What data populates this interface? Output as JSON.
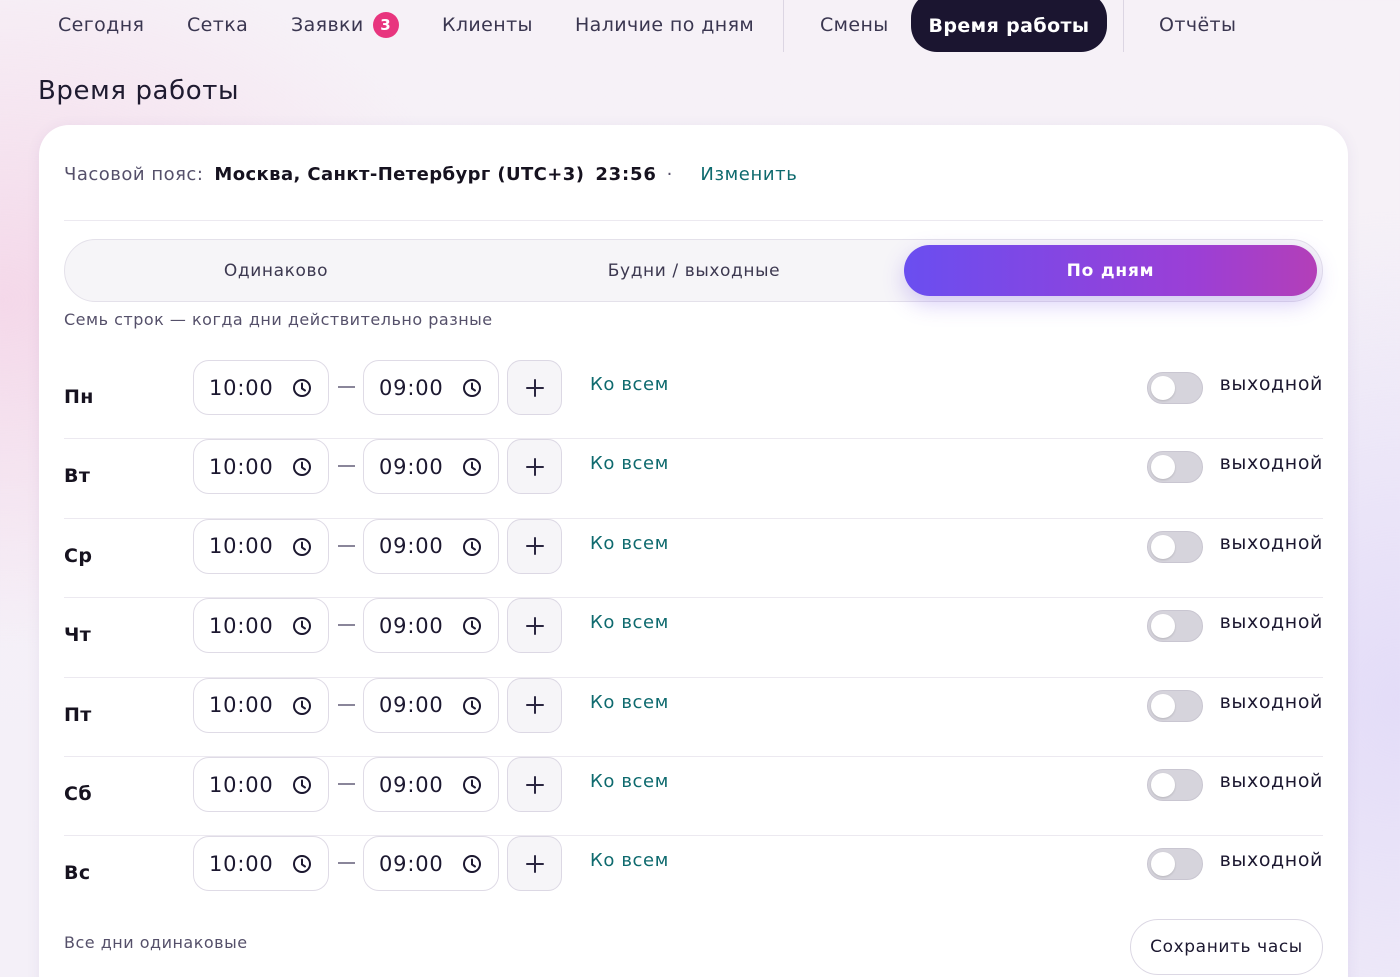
{
  "nav": {
    "items": [
      {
        "label": "Сегодня"
      },
      {
        "label": "Сетка"
      },
      {
        "label": "Заявки",
        "badge": "3"
      },
      {
        "label": "Клиенты"
      },
      {
        "label": "Наличие по дням"
      },
      {
        "label": "Смены"
      },
      {
        "label": "Время работы",
        "active": true
      },
      {
        "label": "Отчёты"
      }
    ]
  },
  "page": {
    "title": "Время работы"
  },
  "timezone": {
    "label": "Часовой пояс:",
    "value": "Москва, Санкт-Петербург (UTC+3)",
    "time": "23:56",
    "separator": "·",
    "change_label": "Изменить"
  },
  "mode": {
    "options": [
      "Одинаково",
      "Будни / выходные",
      "По дням"
    ],
    "selected": "По дням",
    "hint": "Семь строк — когда дни действительно разные"
  },
  "days": [
    {
      "label": "Пн",
      "from": "10:00",
      "to": "09:00",
      "to_all": "Ко всем",
      "day_off": false,
      "day_off_label": "выходной"
    },
    {
      "label": "Вт",
      "from": "10:00",
      "to": "09:00",
      "to_all": "Ко всем",
      "day_off": false,
      "day_off_label": "выходной"
    },
    {
      "label": "Ср",
      "from": "10:00",
      "to": "09:00",
      "to_all": "Ко всем",
      "day_off": false,
      "day_off_label": "выходной"
    },
    {
      "label": "Чт",
      "from": "10:00",
      "to": "09:00",
      "to_all": "Ко всем",
      "day_off": false,
      "day_off_label": "выходной"
    },
    {
      "label": "Пт",
      "from": "10:00",
      "to": "09:00",
      "to_all": "Ко всем",
      "day_off": false,
      "day_off_label": "выходной"
    },
    {
      "label": "Сб",
      "from": "10:00",
      "to": "09:00",
      "to_all": "Ко всем",
      "day_off": false,
      "day_off_label": "выходной"
    },
    {
      "label": "Вс",
      "from": "10:00",
      "to": "09:00",
      "to_all": "Ко всем",
      "day_off": false,
      "day_off_label": "выходной"
    }
  ],
  "footer": {
    "note": "Все дни одинаковые",
    "save_label": "Сохранить часы"
  },
  "colors": {
    "accent_link": "#0e6a6e",
    "nav_active_bg": "#1b1530",
    "badge": "#e8357e",
    "segment_gradient_start": "#6a4ef0",
    "segment_gradient_end": "#b33fb8"
  }
}
